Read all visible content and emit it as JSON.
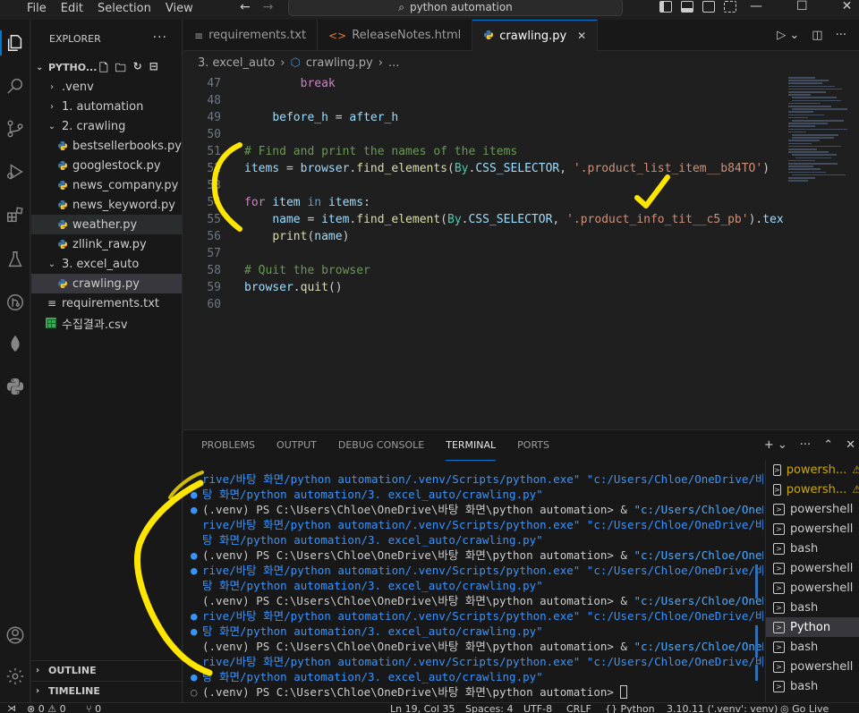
{
  "menu": [
    "File",
    "Edit",
    "Selection",
    "View"
  ],
  "command_center": "python automation",
  "window_controls": [
    "—",
    "☐",
    "✕"
  ],
  "sidebar": {
    "title": "EXPLORER",
    "more": "···",
    "root": "PYTHO...",
    "tree": [
      {
        "label": ".venv",
        "type": "folder",
        "open": false,
        "indent": 1
      },
      {
        "label": "1. automation",
        "type": "folder",
        "open": false,
        "indent": 1
      },
      {
        "label": "2. crawling",
        "type": "folder",
        "open": true,
        "indent": 1
      },
      {
        "label": "bestsellerbooks.py",
        "type": "py",
        "indent": 2
      },
      {
        "label": "googlestock.py",
        "type": "py",
        "indent": 2
      },
      {
        "label": "news_company.py",
        "type": "py",
        "indent": 2
      },
      {
        "label": "news_keyword.py",
        "type": "py",
        "indent": 2
      },
      {
        "label": "weather.py",
        "type": "py",
        "indent": 2,
        "state": "hovered"
      },
      {
        "label": "zllink_raw.py",
        "type": "py",
        "indent": 2
      },
      {
        "label": "3. excel_auto",
        "type": "folder",
        "open": true,
        "indent": 1
      },
      {
        "label": "crawling.py",
        "type": "py",
        "indent": 2,
        "state": "selected"
      },
      {
        "label": "requirements.txt",
        "type": "txt",
        "indent": 1
      },
      {
        "label": "수집결과.csv",
        "type": "csv",
        "indent": 1
      }
    ],
    "outline": "OUTLINE",
    "timeline": "TIMELINE"
  },
  "tabs": [
    {
      "label": "requirements.txt",
      "icon": "≡",
      "active": false
    },
    {
      "label": "ReleaseNotes.html",
      "icon": "<>",
      "active": false
    },
    {
      "label": "crawling.py",
      "icon": "py",
      "active": true,
      "close": "✕"
    }
  ],
  "breadcrumb": {
    "folder": "3. excel_auto",
    "file": "crawling.py",
    "rest": "..."
  },
  "code_lines": [
    {
      "n": "47",
      "indent": "        ",
      "tokens": [
        [
          "kw",
          "break"
        ]
      ]
    },
    {
      "n": "48",
      "indent": "",
      "tokens": []
    },
    {
      "n": "49",
      "indent": "    ",
      "tokens": [
        [
          "var",
          "before_h"
        ],
        [
          "pl",
          " = "
        ],
        [
          "var",
          "after_h"
        ]
      ]
    },
    {
      "n": "50",
      "indent": "",
      "tokens": []
    },
    {
      "n": "51",
      "indent": "",
      "tokens": [
        [
          "com",
          "# Find and print the names of the items"
        ]
      ]
    },
    {
      "n": "52",
      "indent": "",
      "tokens": [
        [
          "var",
          "items"
        ],
        [
          "pl",
          " = "
        ],
        [
          "var",
          "browser"
        ],
        [
          "pl",
          "."
        ],
        [
          "fn",
          "find_elements"
        ],
        [
          "pl",
          "("
        ],
        [
          "cls",
          "By"
        ],
        [
          "pl",
          "."
        ],
        [
          "var",
          "CSS_SELECTOR"
        ],
        [
          "pl",
          ", "
        ],
        [
          "str",
          "'.product_list_item__b84TO'"
        ],
        [
          "pl",
          ")"
        ]
      ]
    },
    {
      "n": "53",
      "indent": "",
      "tokens": []
    },
    {
      "n": "54",
      "indent": "",
      "tokens": [
        [
          "kw",
          "for"
        ],
        [
          "pl",
          " "
        ],
        [
          "var",
          "item"
        ],
        [
          "pl",
          " "
        ],
        [
          "kw2",
          "in"
        ],
        [
          "pl",
          " "
        ],
        [
          "var",
          "items"
        ],
        [
          "pl",
          ":"
        ]
      ]
    },
    {
      "n": "55",
      "indent": "    ",
      "tokens": [
        [
          "var",
          "name"
        ],
        [
          "pl",
          " = "
        ],
        [
          "var",
          "item"
        ],
        [
          "pl",
          "."
        ],
        [
          "fn",
          "find_element"
        ],
        [
          "pl",
          "("
        ],
        [
          "cls",
          "By"
        ],
        [
          "pl",
          "."
        ],
        [
          "var",
          "CSS_SELECTOR"
        ],
        [
          "pl",
          ", "
        ],
        [
          "str",
          "'.product_info_tit__c5_pb'"
        ],
        [
          "pl",
          ")."
        ],
        [
          "var",
          "text"
        ]
      ]
    },
    {
      "n": "56",
      "indent": "    ",
      "tokens": [
        [
          "fn",
          "print"
        ],
        [
          "pl",
          "("
        ],
        [
          "var",
          "name"
        ],
        [
          "pl",
          ")"
        ]
      ]
    },
    {
      "n": "57",
      "indent": "",
      "tokens": []
    },
    {
      "n": "58",
      "indent": "",
      "tokens": [
        [
          "com",
          "# Quit the browser"
        ]
      ]
    },
    {
      "n": "59",
      "indent": "",
      "tokens": [
        [
          "var",
          "browser"
        ],
        [
          "pl",
          "."
        ],
        [
          "fn",
          "quit"
        ],
        [
          "pl",
          "()"
        ]
      ]
    },
    {
      "n": "60",
      "indent": "",
      "tokens": []
    }
  ],
  "panel": {
    "tabs": [
      "PROBLEMS",
      "OUTPUT",
      "DEBUG CONSOLE",
      "TERMINAL",
      "PORTS"
    ],
    "active_tab": "TERMINAL"
  },
  "terminal_lines": [
    {
      "dot": "",
      "parts": [
        [
          "tpath",
          "rive/바탕 화면/python automation/.venv/Scripts/python.exe\" \"c:/Users/Chloe/OneDrive/바"
        ]
      ]
    },
    {
      "dot": "●",
      "parts": [
        [
          "tpath",
          "탕 화면/python automation/3. excel_auto/crawling.py\""
        ]
      ]
    },
    {
      "dot": "●",
      "parts": [
        [
          "pl",
          "(.venv) PS C:\\Users\\Chloe\\OneDrive\\바탕 화면\\python automation> & "
        ],
        [
          "tstr",
          "\"c:/Users/Chloe/OneD"
        ]
      ]
    },
    {
      "dot": "",
      "parts": [
        [
          "tpath",
          "rive/바탕 화면/python automation/.venv/Scripts/python.exe\" \"c:/Users/Chloe/OneDrive/바"
        ]
      ]
    },
    {
      "dot": "",
      "parts": [
        [
          "tpath",
          "탕 화면/python automation/3. excel_auto/crawling.py\""
        ]
      ]
    },
    {
      "dot": "●",
      "parts": [
        [
          "pl",
          "(.venv) PS C:\\Users\\Chloe\\OneDrive\\바탕 화면\\python automation> & "
        ],
        [
          "tstr",
          "\"c:/Users/Chloe/OneD"
        ]
      ]
    },
    {
      "dot": "●",
      "parts": [
        [
          "tpath",
          "rive/바탕 화면/python automation/.venv/Scripts/python.exe\" \"c:/Users/Chloe/OneDrive/바"
        ]
      ]
    },
    {
      "dot": "",
      "parts": [
        [
          "tpath",
          "탕 화면/python automation/3. excel_auto/crawling.py\""
        ]
      ]
    },
    {
      "dot": "",
      "parts": [
        [
          "pl",
          "(.venv) PS C:\\Users\\Chloe\\OneDrive\\바탕 화면\\python automation> & "
        ],
        [
          "tstr",
          "\"c:/Users/Chloe/OneD"
        ]
      ]
    },
    {
      "dot": "●",
      "parts": [
        [
          "tpath",
          "rive/바탕 화면/python automation/.venv/Scripts/python.exe\" \"c:/Users/Chloe/OneDrive/바"
        ]
      ]
    },
    {
      "dot": "●",
      "parts": [
        [
          "tpath",
          "탕 화면/python automation/3. excel_auto/crawling.py\""
        ]
      ]
    },
    {
      "dot": "",
      "parts": [
        [
          "pl",
          "(.venv) PS C:\\Users\\Chloe\\OneDrive\\바탕 화면\\python automation> & "
        ],
        [
          "tstr",
          "\"c:/Users/Chloe/OneD"
        ]
      ]
    },
    {
      "dot": "",
      "parts": [
        [
          "tpath",
          "rive/바탕 화면/python automation/.venv/Scripts/python.exe\" \"c:/Users/Chloe/OneDrive/바"
        ]
      ]
    },
    {
      "dot": "●",
      "parts": [
        [
          "tpath",
          "탕 화면/python automation/3. excel_auto/crawling.py\""
        ]
      ]
    },
    {
      "dot": "○",
      "parts": [
        [
          "pl",
          "(.venv) PS C:\\Users\\Chloe\\OneDrive\\바탕 화면\\python automation> "
        ]
      ],
      "cursor": true
    }
  ],
  "terminals": [
    {
      "label": "powersh...",
      "warn": true
    },
    {
      "label": "powersh...",
      "warn": true
    },
    {
      "label": "powershell"
    },
    {
      "label": "powershell"
    },
    {
      "label": "bash"
    },
    {
      "label": "powershell"
    },
    {
      "label": "powershell"
    },
    {
      "label": "bash"
    },
    {
      "label": "Python",
      "selected": true
    },
    {
      "label": "bash"
    },
    {
      "label": "powershell"
    },
    {
      "label": "bash"
    }
  ],
  "statusbar": {
    "problems": "⊗ 0 ⚠ 0",
    "ports": "⑂ 0",
    "position": "Ln 19, Col 35",
    "spaces": "Spaces: 4",
    "encoding": "UTF-8",
    "eol": "CRLF",
    "language": "{} Python",
    "interpreter": "3.10.11 ('.venv': venv)",
    "golive": "◎ Go Live"
  },
  "colors": {
    "accent": "#0078d4",
    "annotation": "#ffe600"
  }
}
